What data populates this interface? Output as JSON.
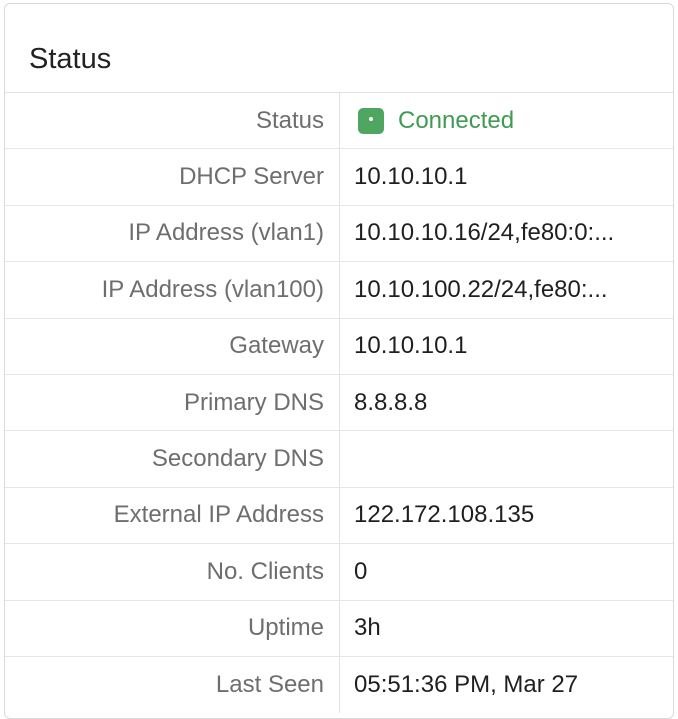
{
  "panel": {
    "title": "Status"
  },
  "rows": [
    {
      "label": "Status",
      "value": "Connected",
      "value_color": "#3f9a52",
      "icon": "connected-status-icon"
    },
    {
      "label": "DHCP Server",
      "value": "10.10.10.1"
    },
    {
      "label": "IP Address (vlan1)",
      "value": "10.10.10.16/24,fe80:0:..."
    },
    {
      "label": "IP Address (vlan100)",
      "value": "10.10.100.22/24,fe80:..."
    },
    {
      "label": "Gateway",
      "value": "10.10.10.1"
    },
    {
      "label": "Primary DNS",
      "value": "8.8.8.8"
    },
    {
      "label": "Secondary DNS",
      "value": ""
    },
    {
      "label": "External IP Address",
      "value": "122.172.108.135"
    },
    {
      "label": "No. Clients",
      "value": "0"
    },
    {
      "label": "Uptime",
      "value": "3h"
    },
    {
      "label": "Last Seen",
      "value": "05:51:36 PM, Mar 27"
    }
  ],
  "colors": {
    "status_connected": "#4ea661",
    "label_text": "#6e6e6e",
    "value_text": "#1f1f1f",
    "border": "#e2e2e2"
  }
}
